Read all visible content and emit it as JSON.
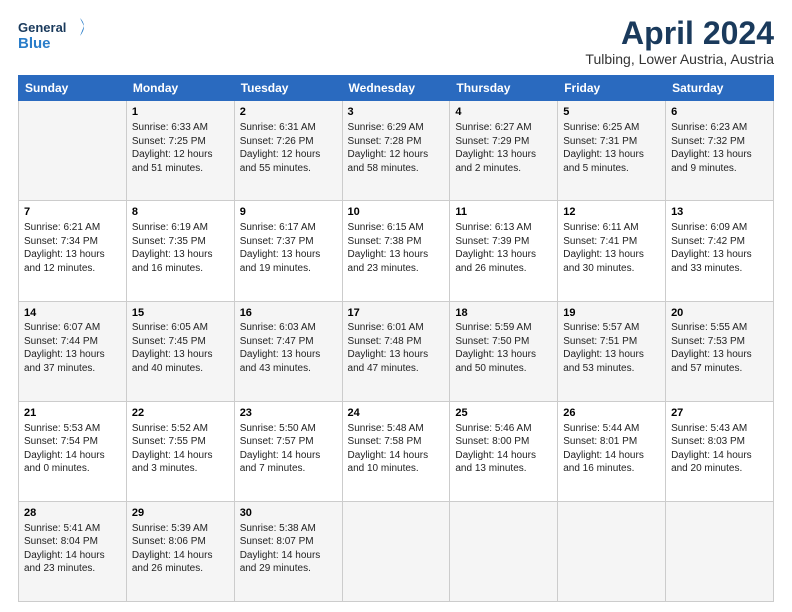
{
  "header": {
    "logo_line1": "General",
    "logo_line2": "Blue",
    "month_title": "April 2024",
    "location": "Tulbing, Lower Austria, Austria"
  },
  "weekdays": [
    "Sunday",
    "Monday",
    "Tuesday",
    "Wednesday",
    "Thursday",
    "Friday",
    "Saturday"
  ],
  "weeks": [
    [
      {
        "day": "",
        "info": ""
      },
      {
        "day": "1",
        "info": "Sunrise: 6:33 AM\nSunset: 7:25 PM\nDaylight: 12 hours\nand 51 minutes."
      },
      {
        "day": "2",
        "info": "Sunrise: 6:31 AM\nSunset: 7:26 PM\nDaylight: 12 hours\nand 55 minutes."
      },
      {
        "day": "3",
        "info": "Sunrise: 6:29 AM\nSunset: 7:28 PM\nDaylight: 12 hours\nand 58 minutes."
      },
      {
        "day": "4",
        "info": "Sunrise: 6:27 AM\nSunset: 7:29 PM\nDaylight: 13 hours\nand 2 minutes."
      },
      {
        "day": "5",
        "info": "Sunrise: 6:25 AM\nSunset: 7:31 PM\nDaylight: 13 hours\nand 5 minutes."
      },
      {
        "day": "6",
        "info": "Sunrise: 6:23 AM\nSunset: 7:32 PM\nDaylight: 13 hours\nand 9 minutes."
      }
    ],
    [
      {
        "day": "7",
        "info": "Sunrise: 6:21 AM\nSunset: 7:34 PM\nDaylight: 13 hours\nand 12 minutes."
      },
      {
        "day": "8",
        "info": "Sunrise: 6:19 AM\nSunset: 7:35 PM\nDaylight: 13 hours\nand 16 minutes."
      },
      {
        "day": "9",
        "info": "Sunrise: 6:17 AM\nSunset: 7:37 PM\nDaylight: 13 hours\nand 19 minutes."
      },
      {
        "day": "10",
        "info": "Sunrise: 6:15 AM\nSunset: 7:38 PM\nDaylight: 13 hours\nand 23 minutes."
      },
      {
        "day": "11",
        "info": "Sunrise: 6:13 AM\nSunset: 7:39 PM\nDaylight: 13 hours\nand 26 minutes."
      },
      {
        "day": "12",
        "info": "Sunrise: 6:11 AM\nSunset: 7:41 PM\nDaylight: 13 hours\nand 30 minutes."
      },
      {
        "day": "13",
        "info": "Sunrise: 6:09 AM\nSunset: 7:42 PM\nDaylight: 13 hours\nand 33 minutes."
      }
    ],
    [
      {
        "day": "14",
        "info": "Sunrise: 6:07 AM\nSunset: 7:44 PM\nDaylight: 13 hours\nand 37 minutes."
      },
      {
        "day": "15",
        "info": "Sunrise: 6:05 AM\nSunset: 7:45 PM\nDaylight: 13 hours\nand 40 minutes."
      },
      {
        "day": "16",
        "info": "Sunrise: 6:03 AM\nSunset: 7:47 PM\nDaylight: 13 hours\nand 43 minutes."
      },
      {
        "day": "17",
        "info": "Sunrise: 6:01 AM\nSunset: 7:48 PM\nDaylight: 13 hours\nand 47 minutes."
      },
      {
        "day": "18",
        "info": "Sunrise: 5:59 AM\nSunset: 7:50 PM\nDaylight: 13 hours\nand 50 minutes."
      },
      {
        "day": "19",
        "info": "Sunrise: 5:57 AM\nSunset: 7:51 PM\nDaylight: 13 hours\nand 53 minutes."
      },
      {
        "day": "20",
        "info": "Sunrise: 5:55 AM\nSunset: 7:53 PM\nDaylight: 13 hours\nand 57 minutes."
      }
    ],
    [
      {
        "day": "21",
        "info": "Sunrise: 5:53 AM\nSunset: 7:54 PM\nDaylight: 14 hours\nand 0 minutes."
      },
      {
        "day": "22",
        "info": "Sunrise: 5:52 AM\nSunset: 7:55 PM\nDaylight: 14 hours\nand 3 minutes."
      },
      {
        "day": "23",
        "info": "Sunrise: 5:50 AM\nSunset: 7:57 PM\nDaylight: 14 hours\nand 7 minutes."
      },
      {
        "day": "24",
        "info": "Sunrise: 5:48 AM\nSunset: 7:58 PM\nDaylight: 14 hours\nand 10 minutes."
      },
      {
        "day": "25",
        "info": "Sunrise: 5:46 AM\nSunset: 8:00 PM\nDaylight: 14 hours\nand 13 minutes."
      },
      {
        "day": "26",
        "info": "Sunrise: 5:44 AM\nSunset: 8:01 PM\nDaylight: 14 hours\nand 16 minutes."
      },
      {
        "day": "27",
        "info": "Sunrise: 5:43 AM\nSunset: 8:03 PM\nDaylight: 14 hours\nand 20 minutes."
      }
    ],
    [
      {
        "day": "28",
        "info": "Sunrise: 5:41 AM\nSunset: 8:04 PM\nDaylight: 14 hours\nand 23 minutes."
      },
      {
        "day": "29",
        "info": "Sunrise: 5:39 AM\nSunset: 8:06 PM\nDaylight: 14 hours\nand 26 minutes."
      },
      {
        "day": "30",
        "info": "Sunrise: 5:38 AM\nSunset: 8:07 PM\nDaylight: 14 hours\nand 29 minutes."
      },
      {
        "day": "",
        "info": ""
      },
      {
        "day": "",
        "info": ""
      },
      {
        "day": "",
        "info": ""
      },
      {
        "day": "",
        "info": ""
      }
    ]
  ]
}
